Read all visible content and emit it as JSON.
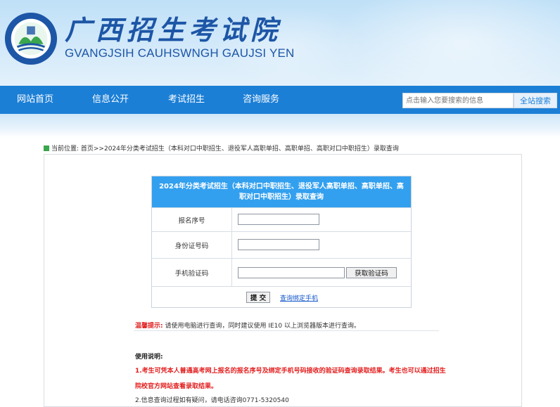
{
  "header": {
    "title": "广西招生考试院",
    "subtitle": "GVANGJSIH CAUHSWNGH GAUJSI YEN"
  },
  "nav": {
    "items": [
      "网站首页",
      "信息公开",
      "考试招生",
      "咨询服务"
    ],
    "search_placeholder": "点击输入您要搜索的信息",
    "search_button": "全站搜索"
  },
  "breadcrumb": {
    "text": "当前位置:  首页>>2024年分类考试招生（本科对口中职招生、退役军人高职单招、高职单招、高职对口中职招生）录取查询"
  },
  "form": {
    "title": "2024年分类考试招生（本科对口中职招生、退役军人高职单招、高职单招、高职对口中职招生）录取查询",
    "fields": [
      {
        "label": "报名序号",
        "value": ""
      },
      {
        "label": "身份证号码",
        "value": ""
      },
      {
        "label": "手机验证码",
        "value": ""
      }
    ],
    "get_code_button": "获取验证码",
    "submit_button": "提 交",
    "bind_phone_link": "查询绑定手机"
  },
  "tip": {
    "label": "温馨提示:",
    "text": "请使用电脑进行查询，同时建议使用 IE10 以上浏览器版本进行查询。"
  },
  "usage": {
    "title": "使用说明:",
    "line1": "1.考生可凭本人普通高考网上报名的报名序号及绑定手机号码接收的验证码查询录取结果。考生也可以通过招生",
    "line2": "院校官方网站查看录取结果。",
    "line3": "2.信息查询过程如有疑问，请电话咨询0771-5320540"
  },
  "colors": {
    "nav": "#1c7fd6",
    "panel_header": "#33a0ef",
    "title": "#1d56a6",
    "warning": "#e31c1c"
  }
}
